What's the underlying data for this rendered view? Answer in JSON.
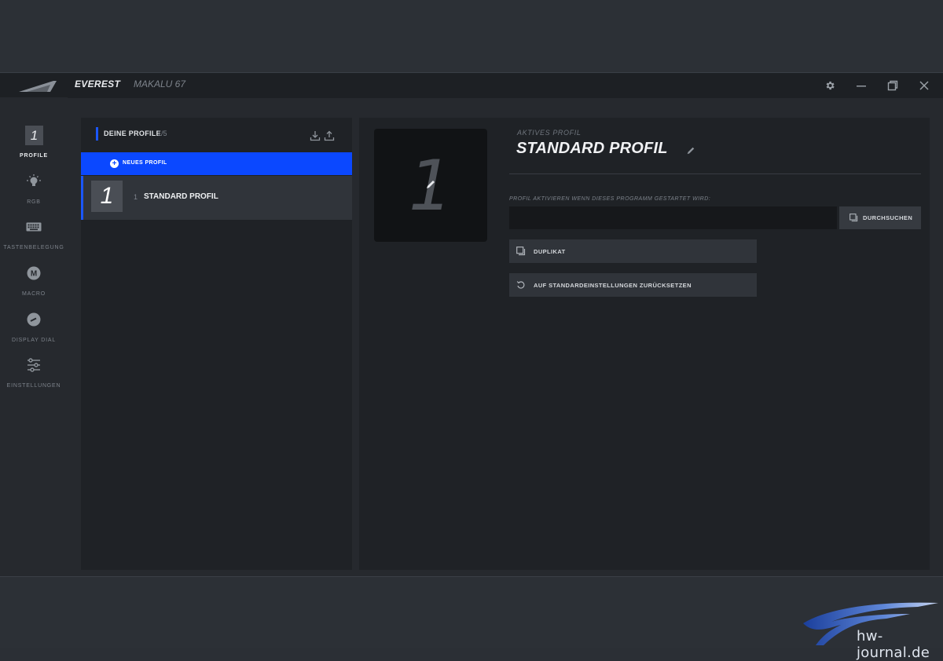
{
  "titlebar": {
    "tab_main": "EVEREST",
    "tab_secondary": "MAKALU 67",
    "icons": [
      "gear-icon",
      "minimize-icon",
      "restore-icon",
      "close-icon"
    ]
  },
  "sidebar": {
    "items": [
      {
        "label": "PROFILE",
        "badge": "1",
        "active": true
      },
      {
        "label": "RGB",
        "icon": "bulb-icon"
      },
      {
        "label": "TASTENBELEGUNG",
        "icon": "keyboard-icon"
      },
      {
        "label": "MACRO",
        "icon": "macro-icon",
        "glyph": "M"
      },
      {
        "label": "DISPLAY DIAL",
        "icon": "dial-icon"
      },
      {
        "label": "EINSTELLUNGEN",
        "icon": "sliders-icon"
      }
    ]
  },
  "profiles_panel": {
    "title": "DEINE PROFILE",
    "count": "1/5",
    "new_profile_label": "NEUES PROFIL",
    "list": [
      {
        "badge": "1",
        "number": "1",
        "name": "STANDARD PROFIL"
      }
    ]
  },
  "active_profile": {
    "badge": "1",
    "label": "AKTIVES PROFIL",
    "name": "STANDARD PROFIL",
    "program_label": "PROFIL AKTIVIEREN WENN DIESES PROGRAMM GESTARTET WIRD:",
    "program_value": "",
    "browse_label": "DURCHSUCHEN",
    "duplicate_label": "DUPLIKAT",
    "reset_label": "AUF STANDARDEINSTELLUNGEN ZURÜCKSETZEN"
  },
  "watermark": {
    "text": "hw-journal.de"
  },
  "colors": {
    "accent": "#0b48ff",
    "background": "#26292e",
    "panel": "#1f2226"
  }
}
